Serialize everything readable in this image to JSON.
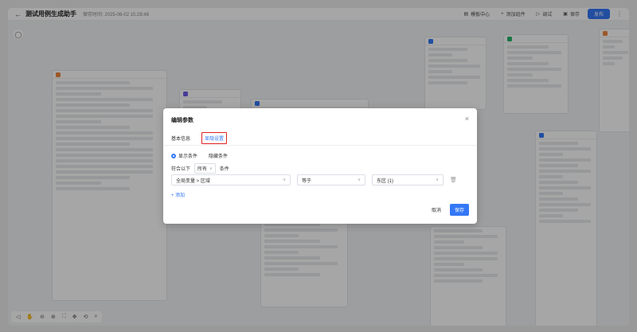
{
  "topbar": {
    "back_icon": "←",
    "title": "测试用例生成助手",
    "saved_text": "保存时间: 2025-06-02 15:28:48",
    "buttons": [
      {
        "icon": "▤",
        "label": "模板中心"
      },
      {
        "icon": "+",
        "label": "添加组件"
      },
      {
        "icon": "▷",
        "label": "调试"
      },
      {
        "icon": "▣",
        "label": "保存"
      }
    ],
    "publish_label": "发布",
    "more_icon": "⋮"
  },
  "modal": {
    "title": "编辑参数",
    "close_icon": "×",
    "tabs": [
      "基本信息",
      "显隐设置"
    ],
    "radio_show": "显示条件",
    "radio_hide": "隐藏条件",
    "match_prefix": "符合以下",
    "match_value": "所有",
    "match_suffix": "条件",
    "condition": {
      "field": "全局变量 > 区域",
      "operator": "等于",
      "value": "东区 (1)"
    },
    "add_label": "+ 添加",
    "cancel_label": "取消",
    "save_label": "保存"
  },
  "canvas_toolbar": [
    "◁",
    "✋",
    "⊖",
    "⊕",
    "⛶",
    "✥",
    "⟲",
    "⌕"
  ]
}
